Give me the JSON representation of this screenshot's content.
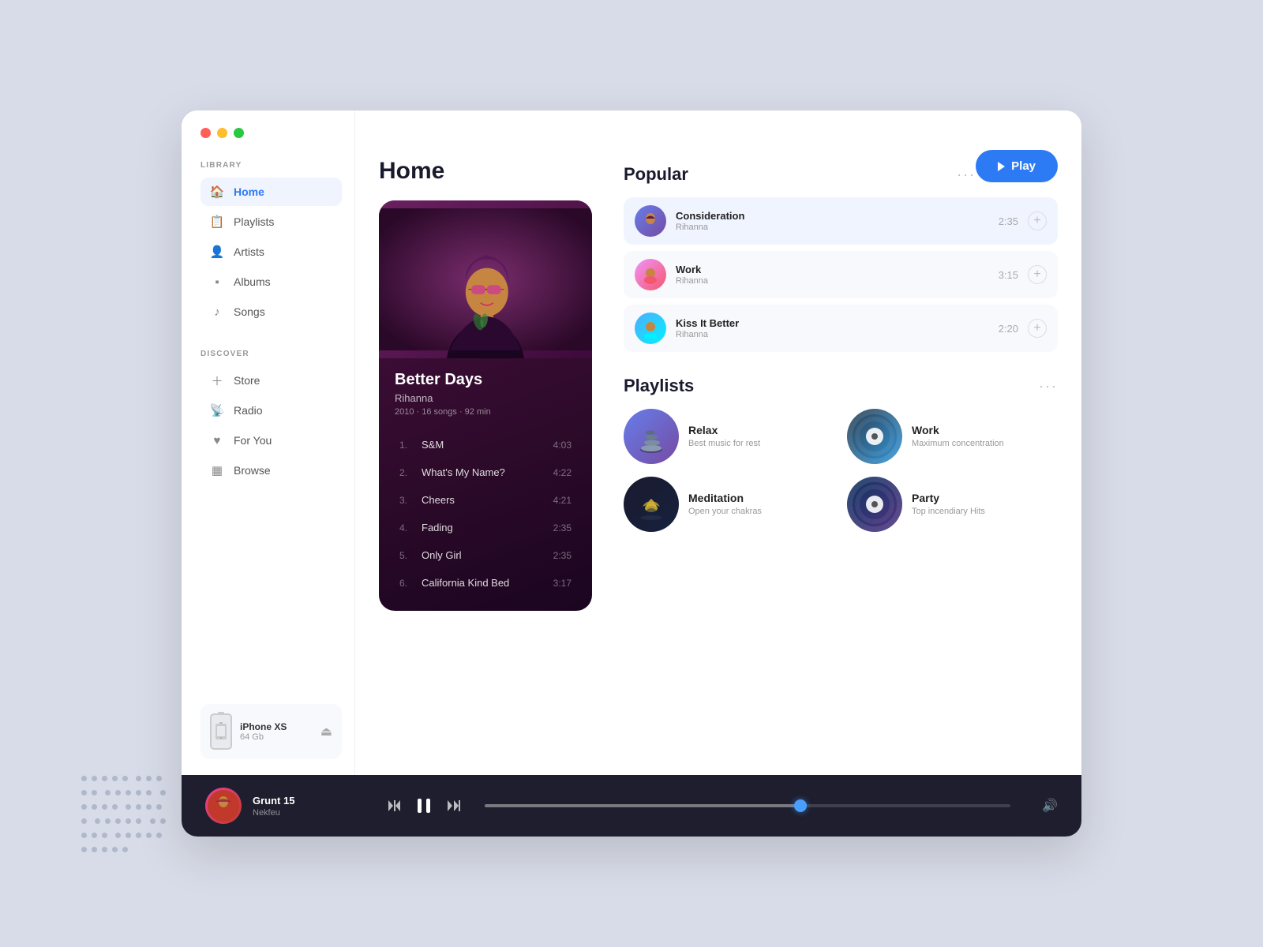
{
  "window": {
    "traffic_lights": [
      "red",
      "yellow",
      "green"
    ]
  },
  "sidebar": {
    "library_label": "LIBRARY",
    "discover_label": "DISCOVER",
    "library_items": [
      {
        "id": "home",
        "label": "Home",
        "active": true
      },
      {
        "id": "playlists",
        "label": "Playlists",
        "active": false
      },
      {
        "id": "artists",
        "label": "Artists",
        "active": false
      },
      {
        "id": "albums",
        "label": "Albums",
        "active": false
      },
      {
        "id": "songs",
        "label": "Songs",
        "active": false
      }
    ],
    "discover_items": [
      {
        "id": "store",
        "label": "Store",
        "active": false
      },
      {
        "id": "radio",
        "label": "Radio",
        "active": false
      },
      {
        "id": "foryou",
        "label": "For You",
        "active": false
      },
      {
        "id": "browse",
        "label": "Browse",
        "active": false
      }
    ],
    "device": {
      "name": "iPhone XS",
      "size": "64 Gb"
    }
  },
  "page": {
    "title": "Home",
    "play_button_label": "Play"
  },
  "album": {
    "title": "Better Days",
    "artist": "Rihanna",
    "meta": "2010 · 16 songs · 92 min",
    "tracks": [
      {
        "number": "1.",
        "name": "S&M",
        "duration": "4:03"
      },
      {
        "number": "2.",
        "name": "What's My Name?",
        "duration": "4:22"
      },
      {
        "number": "3.",
        "name": "Cheers",
        "duration": "4:21"
      },
      {
        "number": "4.",
        "name": "Fading",
        "duration": "2:35"
      },
      {
        "number": "5.",
        "name": "Only Girl",
        "duration": "2:35"
      },
      {
        "number": "6.",
        "name": "California Kind Bed",
        "duration": "3:17"
      }
    ]
  },
  "popular": {
    "section_title": "Popular",
    "items": [
      {
        "name": "Consideration",
        "artist": "Rihanna",
        "duration": "2:35"
      },
      {
        "name": "Work",
        "artist": "Rihanna",
        "duration": "3:15"
      },
      {
        "name": "Kiss It Better",
        "artist": "Rihanna",
        "duration": "2:20"
      }
    ]
  },
  "playlists": {
    "section_title": "Playlists",
    "items": [
      {
        "id": "relax",
        "name": "Relax",
        "desc": "Best music for rest"
      },
      {
        "id": "work",
        "name": "Work",
        "desc": "Maximum concentration"
      },
      {
        "id": "meditation",
        "name": "Meditation",
        "desc": "Open your chakras"
      },
      {
        "id": "party",
        "name": "Party",
        "desc": "Top incendiary Hits"
      }
    ]
  },
  "player": {
    "track_title": "Grunt 15",
    "track_artist": "Nekfeu",
    "progress_percent": 60,
    "volume_icon": "🔊"
  }
}
